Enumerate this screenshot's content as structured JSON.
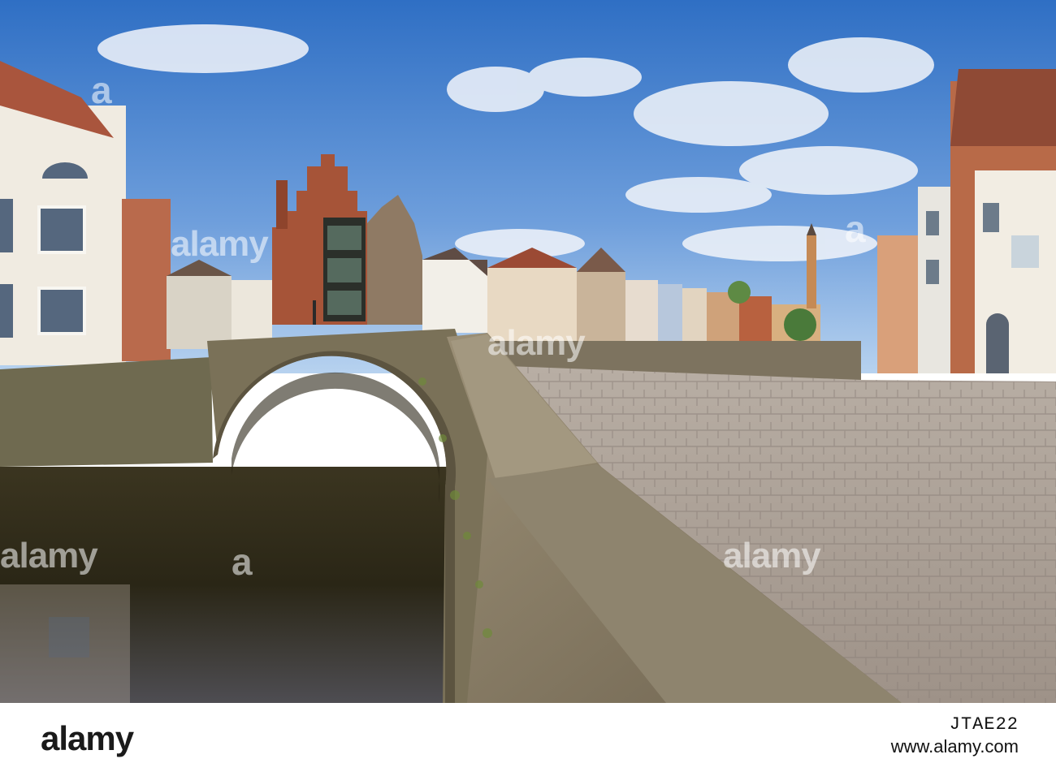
{
  "photo": {
    "subject": "canal-bridge-street",
    "watermark_text": "alamy",
    "watermark_mark": "a",
    "colors": {
      "sky_top": "#2f6fc4",
      "sky_bottom": "#9cc2ea",
      "cloud": "#f2f5fa",
      "brick": "#a65438",
      "stone": "#8b7f66",
      "water": "#2a2616",
      "cobble": "#b3a99f"
    }
  },
  "footer": {
    "brand": "alamy",
    "code": "JTAE22",
    "url": "www.alamy.com"
  }
}
